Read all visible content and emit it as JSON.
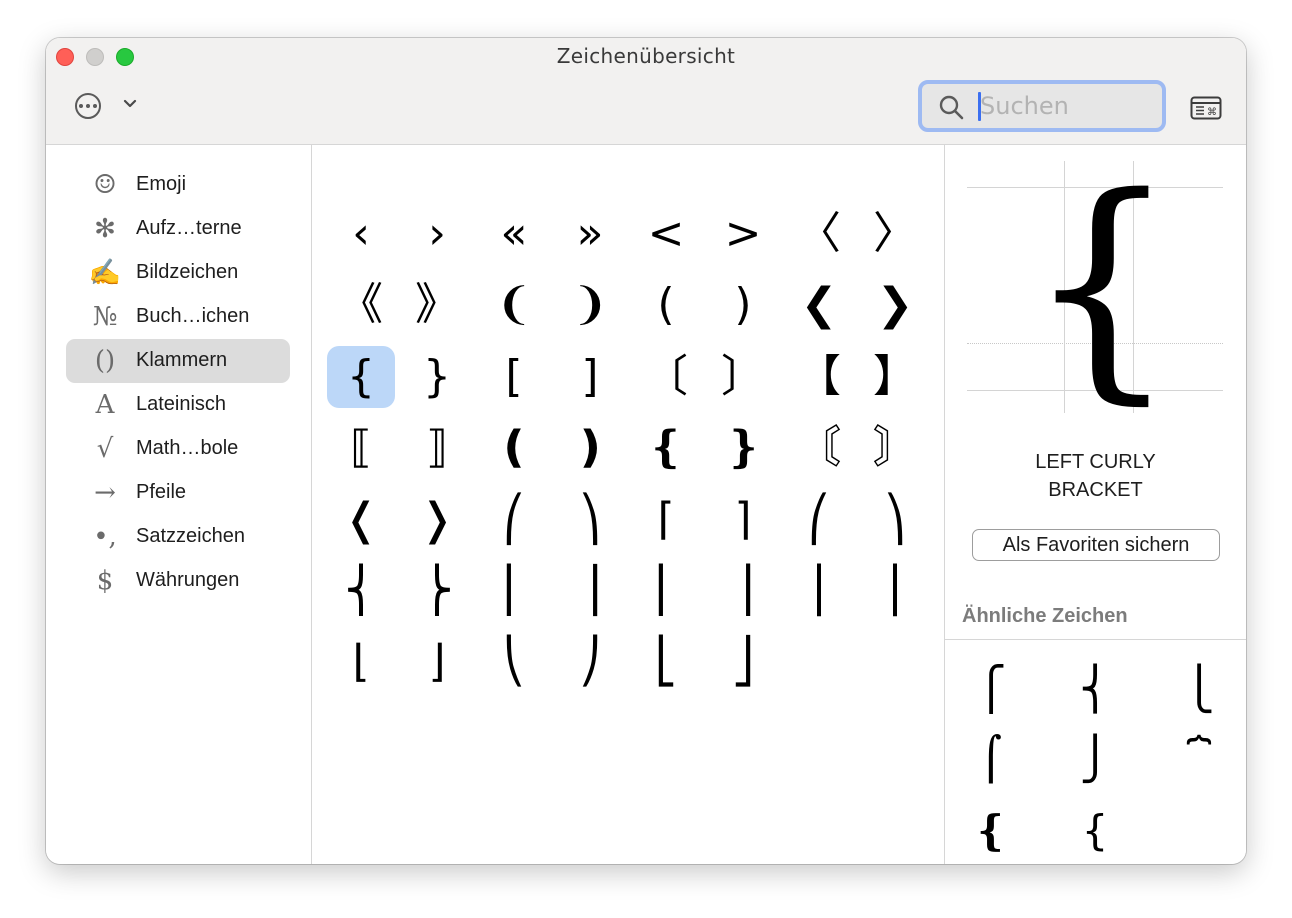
{
  "window": {
    "title": "Zeichenübersicht"
  },
  "toolbar": {
    "more_icon": "ellipsis-circle-icon",
    "dropdown_icon": "chevron-down-icon",
    "search_placeholder": "Suchen",
    "keyboard_icon": "keyboard-viewer-icon"
  },
  "sidebar": {
    "items": [
      {
        "icon": "☺",
        "label": "Emoji",
        "selected": false
      },
      {
        "icon": "✻",
        "label": "Aufz…terne",
        "selected": false
      },
      {
        "icon": "✍",
        "label": "Bildzeichen",
        "selected": false
      },
      {
        "icon": "№",
        "label": "Buch…ichen",
        "selected": false
      },
      {
        "icon": "()",
        "label": "Klammern",
        "selected": true
      },
      {
        "icon": "A",
        "label": "Lateinisch",
        "selected": false
      },
      {
        "icon": "√",
        "label": "Math…bole",
        "selected": false
      },
      {
        "icon": "→",
        "label": "Pfeile",
        "selected": false
      },
      {
        "icon": "•,",
        "label": "Satzzeichen",
        "selected": false
      },
      {
        "icon": "$",
        "label": "Währungen",
        "selected": false
      }
    ]
  },
  "grid": {
    "selected_index": 16,
    "chars": [
      "‹",
      "›",
      "«",
      "»",
      "<",
      ">",
      "〈",
      "〉",
      "《",
      "》",
      "❨",
      "❩",
      "(",
      ")",
      "❮",
      "❯",
      "{",
      "}",
      "[",
      "]",
      "〔",
      "〕",
      "【",
      "】",
      "⟦",
      "⟧",
      "❪",
      "❫",
      "❴",
      "❵",
      "〘",
      "〙",
      "❬",
      "❭",
      "⎛",
      "⎞",
      "⌈",
      "⌉",
      "⎛",
      "⎞",
      "⎨",
      "⎬",
      "⎢",
      "⎥",
      "⎜",
      "⎟",
      "⎪",
      "⎪",
      "⌊",
      "⌋",
      "⎝",
      "⎠",
      "⎣",
      "⎦"
    ]
  },
  "detail": {
    "char": "{",
    "name_line1": "LEFT CURLY",
    "name_line2": "BRACKET",
    "favorite_button": "Als Favoriten sichern",
    "similar_title": "Ähnliche Zeichen",
    "similar_chars": [
      "⎧",
      "⎨",
      "⎩",
      "⌠",
      "⎭",
      "⏞",
      "❴",
      "{"
    ]
  }
}
